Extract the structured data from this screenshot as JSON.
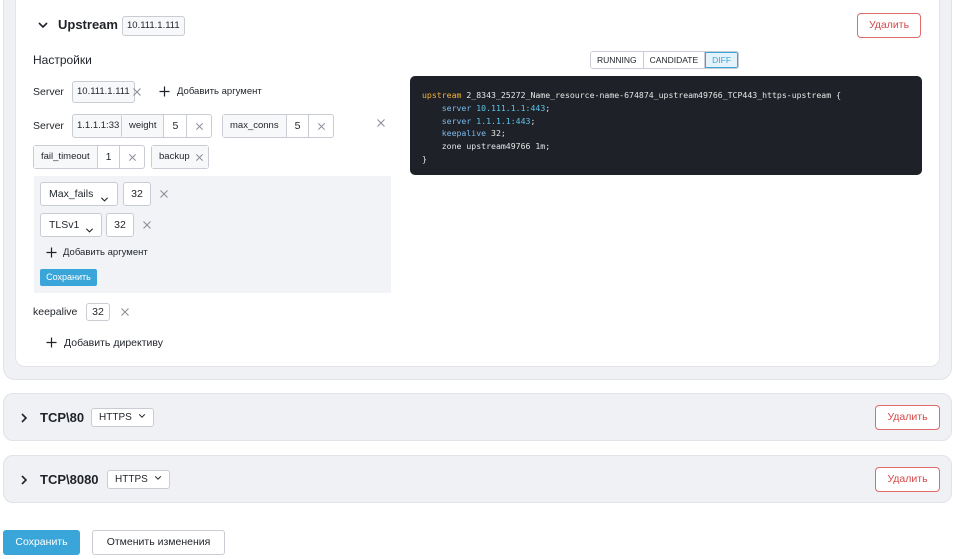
{
  "upstream": {
    "title": "Upstream",
    "ip_tag": "10.111.1.111",
    "delete_label": "Удалить",
    "settings_title": "Настройки",
    "view_tabs": [
      {
        "label": "RUNNING",
        "active": false
      },
      {
        "label": "CANDIDATE",
        "active": false
      },
      {
        "label": "DIFF",
        "active": true
      }
    ],
    "server1": {
      "label": "Server",
      "value": "10.111.1.111",
      "add_arg_label": "Добавить аргумент"
    },
    "server2": {
      "label": "Server",
      "value": "1.1.1.1:33",
      "weight": {
        "key": "weight",
        "value": "5"
      },
      "max_conns": {
        "key": "max_conns",
        "value": "5"
      },
      "fail_timeout": {
        "key": "fail_timeout",
        "value": "1"
      },
      "backup": {
        "key": "backup"
      }
    },
    "panel": {
      "max_fails": {
        "label": "Max_fails",
        "value": "32"
      },
      "tls": {
        "label": "TLSv1",
        "value": "32"
      },
      "add_arg_label": "Добавить аргумент",
      "save_label": "Сохранить"
    },
    "keepalive": {
      "label": "keepalive",
      "value": "32"
    },
    "add_directive_label": "Добавить директиву",
    "code": {
      "line1_kw": "upstream",
      "line1_rest": " 2_8343_25272_Name_resource-name-674874_upstream49766_TCP443_https-upstream {",
      "line2_kw": "server",
      "line2_val": "10.111.1.1:443",
      "line3_kw": "server",
      "line3_val": "1.1.1.1:443",
      "line4_kw": "keepalive",
      "line4_rest": " 32;",
      "line5": "zone upstream49766 1m;",
      "line6": "}"
    }
  },
  "cards": [
    {
      "title": "TCP\\80",
      "protocol": "HTTPS",
      "delete_label": "Удалить"
    },
    {
      "title": "TCP\\8080",
      "protocol": "HTTPS",
      "delete_label": "Удалить"
    }
  ],
  "footer": {
    "save_label": "Сохранить",
    "cancel_label": "Отменить изменения"
  },
  "colors": {
    "accent": "#3aa5d8",
    "danger": "#d44848",
    "code_bg": "#1f2128"
  }
}
